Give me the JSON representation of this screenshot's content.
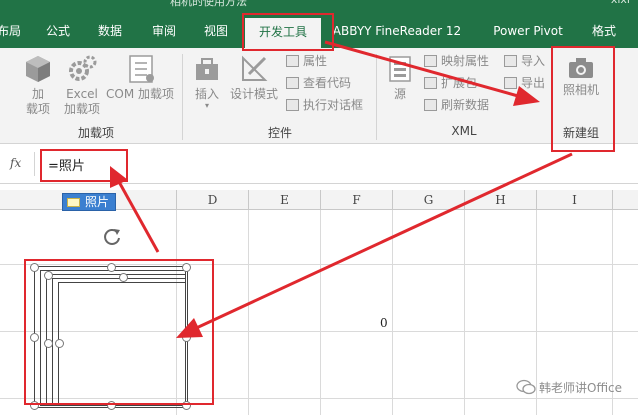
{
  "title_bar": {
    "title": "相机的使用方法",
    "user": "xixi"
  },
  "tabs": [
    {
      "label": "布局",
      "active": false
    },
    {
      "label": "公式",
      "active": false
    },
    {
      "label": "数据",
      "active": false
    },
    {
      "label": "审阅",
      "active": false
    },
    {
      "label": "视图",
      "active": false
    },
    {
      "label": "开发工具",
      "active": true
    },
    {
      "label": "ABBYY FineReader 12",
      "active": false
    },
    {
      "label": "Power Pivot",
      "active": false
    },
    {
      "label": "格式",
      "active": false
    }
  ],
  "ribbon": {
    "addins": {
      "label": "加载项",
      "buttons": [
        {
          "label": "加\n载项",
          "icon": "cube-icon"
        },
        {
          "label": "Excel\n加载项",
          "icon": "gears-icon"
        },
        {
          "label": "COM 加载项",
          "icon": "com-addin-icon"
        }
      ]
    },
    "controls": {
      "label": "控件",
      "insert": "插入",
      "design_mode": "设计模式",
      "properties": "属性",
      "view_code": "查看代码",
      "run_dialog": "执行对话框"
    },
    "xml": {
      "label": "XML",
      "source": "源",
      "map_properties": "映射属性",
      "expansion_pack": "扩展包",
      "refresh_data": "刷新数据",
      "import": "导入",
      "export": "导出"
    },
    "new_group": {
      "label": "新建组",
      "camera": "照相机"
    }
  },
  "formula_bar": {
    "fx_label": "fx",
    "formula": "=照片"
  },
  "columns": [
    "D",
    "E",
    "F",
    "G",
    "H",
    "I"
  ],
  "name_tip": "照片",
  "cell_value": "0",
  "watermark": "韩老师讲Office",
  "colors": {
    "excel_green": "#217346",
    "annotation_red": "#e0282e",
    "tip_blue": "#3b7fd0"
  }
}
